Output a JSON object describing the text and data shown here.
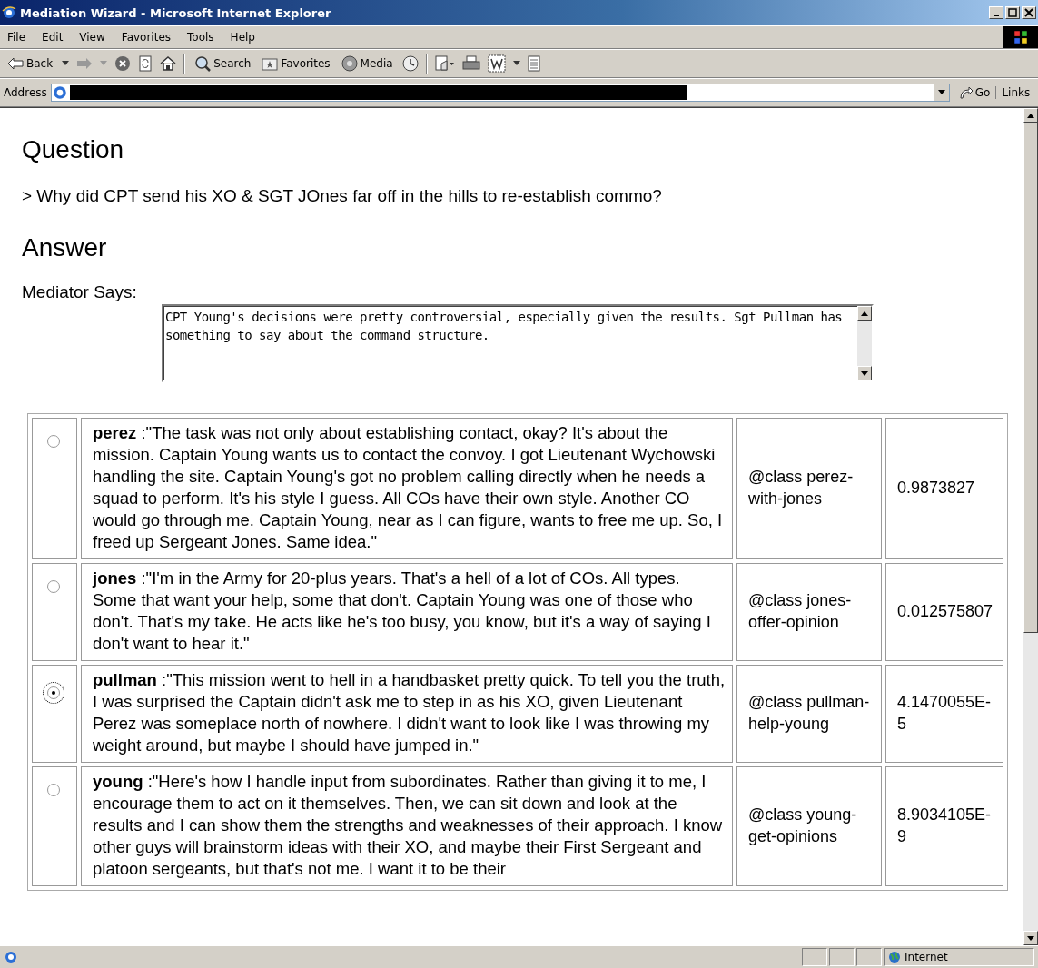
{
  "window": {
    "title": "Mediation Wizard - Microsoft Internet Explorer"
  },
  "menu": [
    "File",
    "Edit",
    "View",
    "Favorites",
    "Tools",
    "Help"
  ],
  "toolbar": {
    "back": "Back",
    "search": "Search",
    "favorites": "Favorites",
    "media": "Media"
  },
  "address_bar": {
    "label": "Address",
    "go": "Go",
    "links": "Links"
  },
  "question": {
    "heading": "Question",
    "text": "> Why did CPT send his XO & SGT JOnes far off in the hills to re-establish commo?"
  },
  "answer": {
    "heading": "Answer",
    "mediator_label": "Mediator Says:",
    "mediator_text": "CPT Young's decisions were pretty controversial, especially given the results. Sgt Pullman has something to say about the command structure."
  },
  "rows": [
    {
      "selected": false,
      "speaker": "perez",
      "quote": ":\"The task was not only about establishing contact, okay? It's about the mission. Captain Young wants us to contact the convoy. I got Lieutenant Wychowski handling the site. Captain Young's got no problem calling directly when he needs a squad to perform. It's his style I guess. All COs have their own style. Another CO would go through me. Captain Young, near as I can figure, wants to free me up. So, I freed up Sergeant Jones. Same idea.\"",
      "class": "@class perez-with-jones",
      "score": "0.9873827"
    },
    {
      "selected": false,
      "speaker": "jones",
      "quote": ":\"I'm in the Army for 20-plus years. That's a hell of a lot of COs. All types. Some that want your help, some that don't. Captain Young was one of those who don't. That's my take. He acts like he's too busy, you know, but it's a way of saying I don't want to hear it.\"",
      "class": "@class jones-offer-opinion",
      "score": "0.012575807"
    },
    {
      "selected": true,
      "speaker": "pullman",
      "quote": ":\"This mission went to hell in a handbasket pretty quick. To tell you the truth, I was surprised the Captain didn't ask me to step in as his XO, given Lieutenant Perez was someplace north of nowhere. I didn't want to look like I was throwing my weight around, but maybe I should have jumped in.\"",
      "class": "@class pullman-help-young",
      "score": "4.1470055E-5"
    },
    {
      "selected": false,
      "speaker": "young",
      "quote": ":\"Here's how I handle input from subordinates. Rather than giving it to me, I encourage them to act on it themselves. Then, we can sit down and look at the results and I can show them the strengths and weaknesses of their approach. I know other guys will brainstorm ideas with their XO, and maybe their First Sergeant and platoon sergeants, but that's not me. I want it to be their",
      "class": "@class young-get-opinions",
      "score": "8.9034105E-9"
    }
  ],
  "status_bar": {
    "zone": "Internet"
  }
}
